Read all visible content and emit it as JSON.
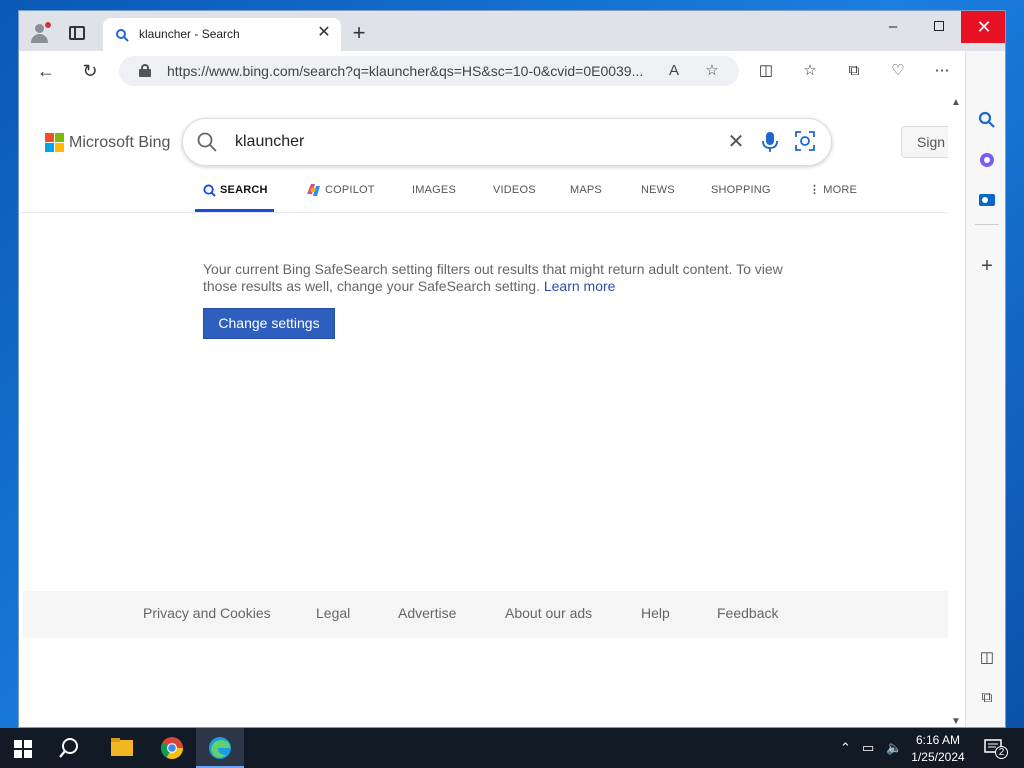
{
  "browser": {
    "tab_title": "klauncher - Search",
    "url": "https://www.bing.com/search?q=klauncher&qs=HS&sc=10-0&cvid=0E0039...",
    "window_controls": {
      "minimize": "–",
      "close": "✕"
    }
  },
  "bing": {
    "brand": "Microsoft Bing",
    "query": "klauncher",
    "sign_in": "Sign",
    "scopes": [
      "SEARCH",
      "COPILOT",
      "IMAGES",
      "VIDEOS",
      "MAPS",
      "NEWS",
      "SHOPPING",
      "MORE"
    ],
    "safesearch_notice": "Your current Bing SafeSearch setting filters out results that might return adult content. To view those results as well, change your SafeSearch setting.",
    "learn_more": "Learn more",
    "change_settings": "Change settings",
    "footer_links": [
      "Privacy and Cookies",
      "Legal",
      "Advertise",
      "About our ads",
      "Help",
      "Feedback"
    ]
  },
  "taskbar": {
    "time": "6:16 AM",
    "date": "1/25/2024",
    "notification_count": "2"
  },
  "colors": {
    "accent": "#174ae4",
    "button": "#2f5fbe",
    "close_red": "#e81123"
  }
}
